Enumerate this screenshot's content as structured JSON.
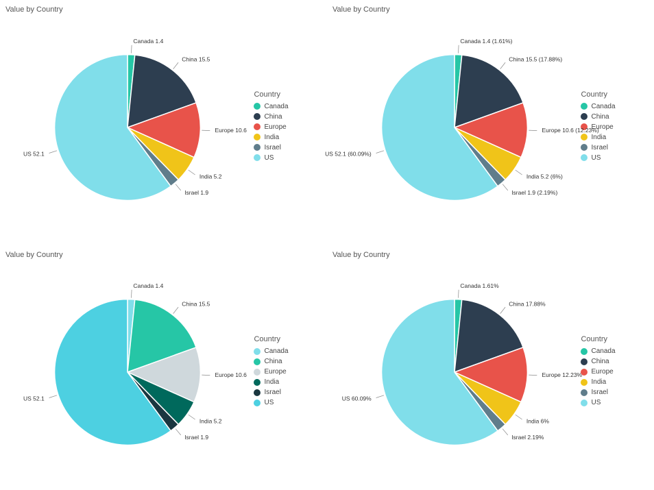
{
  "charts": [
    {
      "id": "chart1",
      "title": "Value by Country",
      "legendTitle": "Country",
      "showPercentages": false,
      "slices": [
        {
          "country": "Canada",
          "value": 1.4,
          "pct": 1.61,
          "color": "#26C6A6"
        },
        {
          "country": "China",
          "value": 15.5,
          "pct": 17.88,
          "color": "#2D3E50"
        },
        {
          "country": "Europe",
          "value": 10.6,
          "pct": 12.23,
          "color": "#E8534A"
        },
        {
          "country": "India",
          "value": 5.2,
          "pct": 6.0,
          "color": "#F0C419"
        },
        {
          "country": "Israel",
          "value": 1.9,
          "pct": 2.19,
          "color": "#607D8B"
        },
        {
          "country": "US",
          "value": 52.1,
          "pct": 60.09,
          "color": "#80DEEA"
        }
      ]
    },
    {
      "id": "chart2",
      "title": "Value by Country",
      "legendTitle": "Country",
      "showPercentages": true,
      "slices": [
        {
          "country": "Canada",
          "value": 1.4,
          "pct": 1.61,
          "color": "#26C6A6"
        },
        {
          "country": "China",
          "value": 15.5,
          "pct": 17.88,
          "color": "#2D3E50"
        },
        {
          "country": "Europe",
          "value": 10.6,
          "pct": 12.23,
          "color": "#E8534A"
        },
        {
          "country": "India",
          "value": 5.2,
          "pct": 6.0,
          "color": "#F0C419"
        },
        {
          "country": "Israel",
          "value": 1.9,
          "pct": 2.19,
          "color": "#607D8B"
        },
        {
          "country": "US",
          "value": 52.1,
          "pct": 60.09,
          "color": "#80DEEA"
        }
      ]
    },
    {
      "id": "chart3",
      "title": "Value by Country",
      "legendTitle": "Country",
      "showPercentages": false,
      "altColors": true,
      "slices": [
        {
          "country": "Canada",
          "value": 1.4,
          "pct": 1.61,
          "color": "#80DEEA"
        },
        {
          "country": "China",
          "value": 15.5,
          "pct": 17.88,
          "color": "#26C6A6"
        },
        {
          "country": "Europe",
          "value": 10.6,
          "pct": 12.23,
          "color": "#CFD8DC"
        },
        {
          "country": "India",
          "value": 5.2,
          "pct": 6.0,
          "color": "#00695C"
        },
        {
          "country": "Israel",
          "value": 1.9,
          "pct": 2.19,
          "color": "#1A3740"
        },
        {
          "country": "US",
          "value": 52.1,
          "pct": 60.09,
          "color": "#4DD0E1"
        }
      ]
    },
    {
      "id": "chart4",
      "title": "Value by Country",
      "legendTitle": "Country",
      "showPercentages": true,
      "pctOnly": true,
      "slices": [
        {
          "country": "Canada",
          "value": 1.4,
          "pct": 1.61,
          "color": "#26C6A6"
        },
        {
          "country": "China",
          "value": 15.5,
          "pct": 17.88,
          "color": "#2D3E50"
        },
        {
          "country": "Europe",
          "value": 10.6,
          "pct": 12.23,
          "color": "#E8534A"
        },
        {
          "country": "India",
          "value": 5.2,
          "pct": 6.0,
          "color": "#F0C419"
        },
        {
          "country": "Israel",
          "value": 1.9,
          "pct": 2.19,
          "color": "#607D8B"
        },
        {
          "country": "US",
          "value": 52.1,
          "pct": 60.09,
          "color": "#80DEEA"
        }
      ]
    }
  ]
}
